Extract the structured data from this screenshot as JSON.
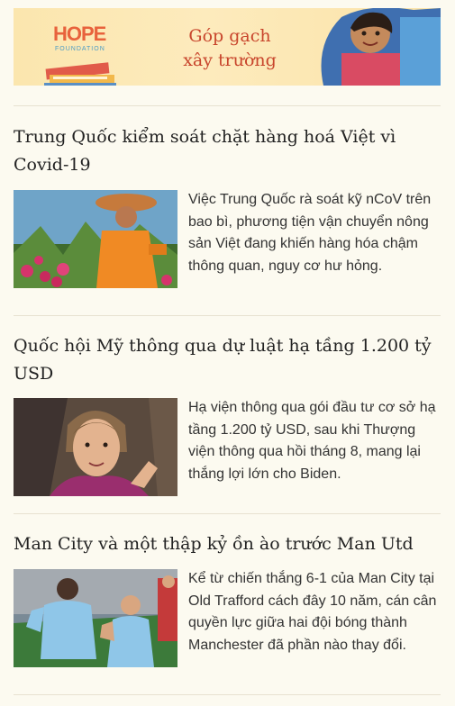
{
  "banner": {
    "logo": "HOPE",
    "logo_sub": "FOUNDATION",
    "tagline_line1": "Góp gạch",
    "tagline_line2": "xây trường"
  },
  "articles": [
    {
      "title": "Trung Quốc kiểm soát chặt hàng hoá Việt vì Covid-19",
      "lead": "Việc Trung Quốc rà soát kỹ nCoV trên bao bì, phương tiện vận chuyển nông sản Việt đang khiến hàng hóa chậm thông quan, nguy cơ hư hỏng."
    },
    {
      "title": "Quốc hội Mỹ thông qua dự luật hạ tầng 1.200 tỷ USD",
      "lead": "Hạ viện thông qua gói đầu tư cơ sở hạ tầng 1.200 tỷ USD, sau khi Thượng viện thông qua hồi tháng 8, mang lại thắng lợi lớn cho Biden."
    },
    {
      "title": "Man City và một thập kỷ ồn ào trước Man Utd",
      "lead": "Kể từ chiến thắng 6-1 của Man City tại Old Trafford cách đây 10 năm, cán cân quyền lực giữa hai đội bóng thành Manchester đã phần nào thay đổi."
    }
  ]
}
